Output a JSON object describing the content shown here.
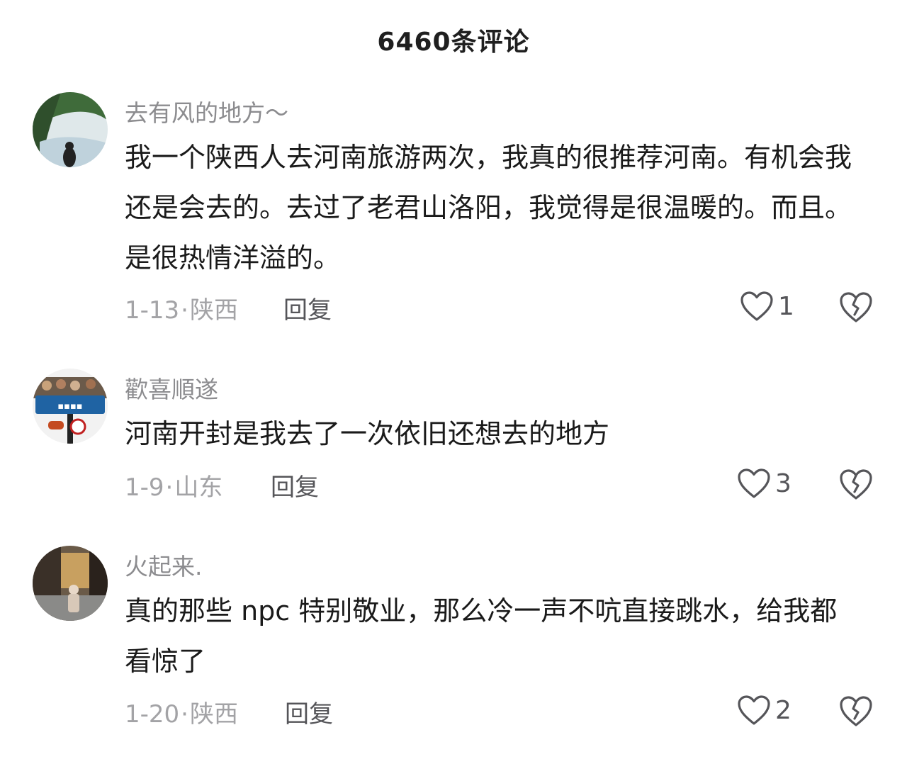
{
  "header": {
    "title": "6460条评论"
  },
  "comments": [
    {
      "username": "去有风的地方～",
      "text": "我一个陕西人去河南旅游两次，我真的很推荐河南。有机会我还是会去的。去过了老君山洛阳，我觉得是很温暖的。而且。是很热情洋溢的。",
      "date": "1-13",
      "location": "陕西",
      "reply_label": "回复",
      "likes": "1"
    },
    {
      "username": "歡喜順遂",
      "text": "河南开封是我去了一次依旧还想去的地方",
      "date": "1-9",
      "location": "山东",
      "reply_label": "回复",
      "likes": "3"
    },
    {
      "username": "火起来.",
      "text": "真的那些 npc 特别敬业，那么冷一声不吭直接跳水，给我都看惊了",
      "date": "1-20",
      "location": "陕西",
      "reply_label": "回复",
      "likes": "2"
    }
  ],
  "icons": {
    "like": "heart-outline-icon",
    "dislike": "broken-heart-icon"
  },
  "colors": {
    "username": "#8c8c8f",
    "meta": "#a3a3a6",
    "text": "#1a1a1a"
  }
}
